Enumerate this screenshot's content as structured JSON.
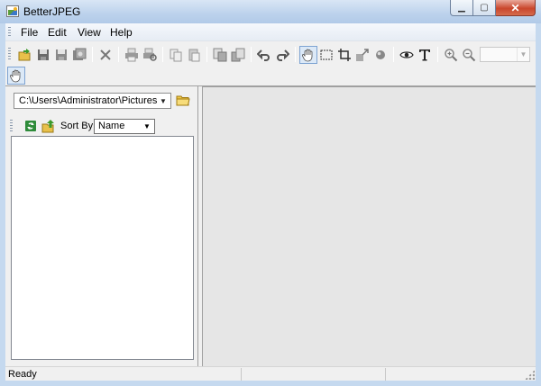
{
  "window": {
    "title": "BetterJPEG"
  },
  "menu": {
    "items": [
      "File",
      "Edit",
      "View",
      "Help"
    ]
  },
  "toolbar": {
    "icons": [
      "open-folder-icon",
      "save-icon",
      "save-as-icon",
      "save-copy-icon",
      "delete-icon",
      "print-icon",
      "print-preview-icon",
      "copy-icon",
      "paste-icon",
      "copy-region-icon",
      "paste-region-icon",
      "undo-icon",
      "redo-icon",
      "hand-tool-icon",
      "select-rect-icon",
      "crop-icon",
      "resize-icon",
      "redeye-icon",
      "preview-eye-icon",
      "text-tool-icon",
      "zoom-in-icon",
      "zoom-out-icon"
    ],
    "active_tool": "hand-tool-icon",
    "zoom_value": ""
  },
  "browser": {
    "path": "C:\\Users\\Administrator\\Pictures",
    "sort_label": "Sort By:",
    "sort_value": "Name"
  },
  "status": {
    "text": "Ready"
  }
}
